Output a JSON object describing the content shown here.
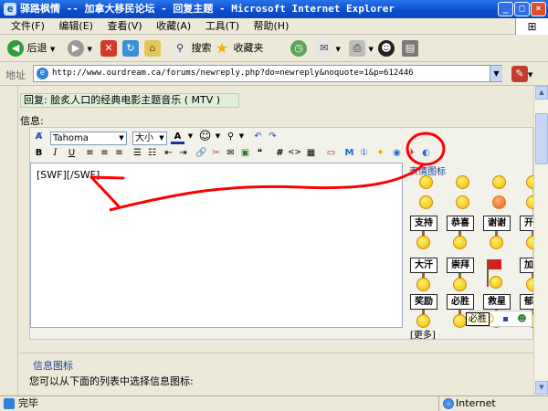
{
  "window": {
    "title": "驿路枫情 -- 加拿大移民论坛 - 回复主题 - Microsoft Internet Explorer",
    "minimize": "_",
    "maximize": "□",
    "close": "×"
  },
  "menu": {
    "items": [
      "文件(F)",
      "编辑(E)",
      "查看(V)",
      "收藏(A)",
      "工具(T)",
      "帮助(H)"
    ]
  },
  "toolbar": {
    "back": "后退",
    "search": "搜索",
    "favorites": "收藏夹"
  },
  "address": {
    "label": "地址",
    "url": "http://www.ourdream.ca/forums/newreply.php?do=newreply&noquote=1&p=612446"
  },
  "form": {
    "reply_title": "回复: 脍炙人口的经典电影主题音乐 ( MTV )",
    "message_label": "信息:",
    "font_name": "Tahoma",
    "font_size": "大小",
    "message_text": "[SWF][/SWF]"
  },
  "smilies": {
    "title": "表情图标",
    "signs": [
      {
        "text": "支持"
      },
      {
        "text": "恭喜"
      },
      {
        "text": "谢谢"
      },
      {
        "text": "开心"
      },
      {
        "text": "大汗"
      },
      {
        "text": "崇拜"
      },
      {
        "text": "加油"
      },
      {
        "text": "奖励"
      },
      {
        "text": "必胜"
      },
      {
        "text": "救星"
      },
      {
        "text": "郁闷"
      }
    ],
    "more": "[更多]",
    "tooltip": "必胜"
  },
  "message_icons": {
    "title": "信息图标",
    "description": "您可以从下面的列表中选择信息图标:"
  },
  "status": {
    "text": "完毕",
    "zone": "Internet"
  },
  "colors": {
    "titlebar": "#0a4fd0",
    "annotation": "#ff0000",
    "reply_bg": "#e1efd8",
    "chrome": "#ece9d8"
  }
}
